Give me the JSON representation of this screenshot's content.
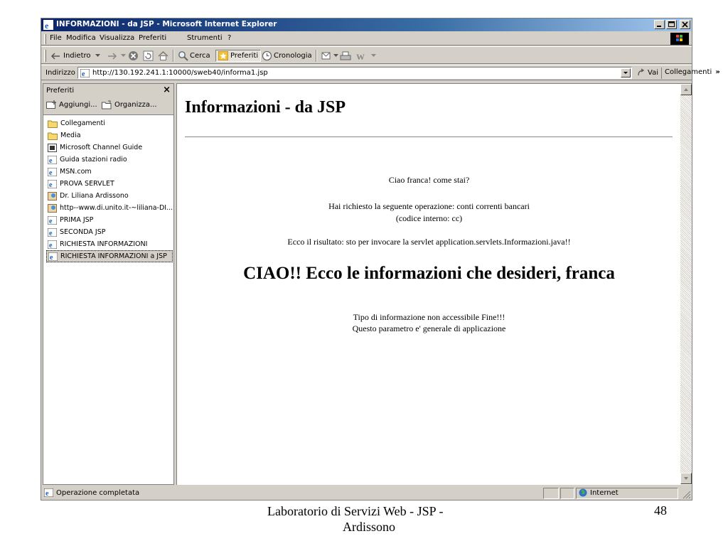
{
  "window": {
    "title": "INFORMAZIONI - da JSP - Microsoft Internet Explorer"
  },
  "menu": {
    "items": [
      "File",
      "Modifica",
      "Visualizza",
      "Preferiti",
      "Strumenti",
      "?"
    ]
  },
  "toolbar": {
    "back_label": "Indietro",
    "search_label": "Cerca",
    "favorites_label": "Preferiti",
    "history_label": "Cronologia"
  },
  "address": {
    "label": "Indirizzo",
    "url": "http://130.192.241.1:10000/sweb40/informa1.jsp",
    "go_label": "Vai",
    "links_label": "Collegamenti"
  },
  "sidebar": {
    "title": "Preferiti",
    "add_label": "Aggiungi...",
    "organize_label": "Organizza...",
    "items": [
      {
        "label": "Collegamenti",
        "icon": "folder-icon"
      },
      {
        "label": "Media",
        "icon": "folder-icon"
      },
      {
        "label": "Microsoft Channel Guide",
        "icon": "channel-icon"
      },
      {
        "label": "Guida stazioni radio",
        "icon": "ie-page-icon"
      },
      {
        "label": "MSN.com",
        "icon": "ie-page-icon"
      },
      {
        "label": "PROVA SERVLET",
        "icon": "ie-page-icon"
      },
      {
        "label": "Dr. Liliana Ardissono",
        "icon": "image-page-icon"
      },
      {
        "label": "http--www.di.unito.it-~liliana-DI...",
        "icon": "image-page-icon"
      },
      {
        "label": "PRIMA JSP",
        "icon": "ie-page-icon"
      },
      {
        "label": "SECONDA JSP",
        "icon": "ie-page-icon"
      },
      {
        "label": "RICHIESTA INFORMAZIONI",
        "icon": "ie-page-icon"
      },
      {
        "label": "RICHIESTA INFORMAZIONI a JSP",
        "icon": "ie-page-icon"
      }
    ]
  },
  "page": {
    "heading": "Informazioni - da JSP",
    "greeting": "Ciao franca! come stai?",
    "request_line1": "Hai richiesto la seguente operazione: conti correnti bancari",
    "request_line2": "(codice interno: cc)",
    "result": "Ecco il risultato: sto per invocare la servlet application.servlets.Informazioni.java!!",
    "big_message": "CIAO!! Ecco le informazioni che desideri, franca",
    "info_line1": "Tipo di informazione non accessibile Fine!!!",
    "info_line2": "Questo parametro e' generale di applicazione"
  },
  "status": {
    "text": "Operazione completata",
    "zone": "Internet"
  },
  "slide": {
    "caption_line1": "Laboratorio di Servizi Web - JSP -",
    "caption_line2": "Ardissono",
    "page_number": "48"
  },
  "colors": {
    "titlebar_start": "#0a246a",
    "titlebar_end": "#a6caf0",
    "chrome": "#d4d0c8"
  }
}
